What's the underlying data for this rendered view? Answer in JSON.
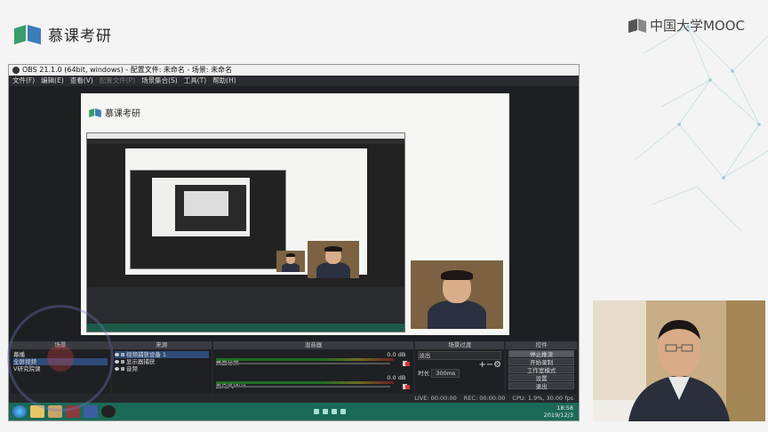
{
  "brand": {
    "name": "慕课考研"
  },
  "mooc": {
    "label": "中国大学MOOC"
  },
  "obs": {
    "title": "OBS 21.1.0 (64bit, windows) - 配置文件: 未命名 - 场景: 未命名",
    "menu": [
      "文件(F)",
      "编辑(E)",
      "查看(V)",
      "配置文件(P)",
      "场景集合(S)",
      "工具(T)",
      "帮助(H)"
    ],
    "menu_disabled_index": 3,
    "canvas_brand": "慕课考研",
    "docks": {
      "scenes": {
        "title": "场景",
        "items": [
          "幕播",
          "全屏视频",
          "V研究院课"
        ]
      },
      "sources": {
        "title": "来源",
        "items": [
          "视频捕获设备 1",
          "显示器捕获",
          "音频"
        ]
      },
      "mixer": {
        "title": "混音器",
        "tracks": [
          {
            "name": "桌面音频",
            "db": "0.0 dB"
          },
          {
            "name": "麦克风/Aux",
            "db": "0.0 dB"
          }
        ]
      },
      "transitions": {
        "title": "场景过渡",
        "type": "淡出",
        "duration_label": "时长",
        "duration": "300ms"
      },
      "controls": {
        "title": "控件",
        "buttons": [
          "停止推流",
          "开始录制",
          "工作室模式",
          "设置",
          "退出"
        ]
      }
    },
    "status": {
      "live": "LIVE: 00:00:00",
      "rec": "REC: 00:00:00",
      "cpu": "CPU: 1.9%, 30.00 fps"
    },
    "clock": {
      "time": "18:58",
      "date": "2019/12/3"
    }
  }
}
